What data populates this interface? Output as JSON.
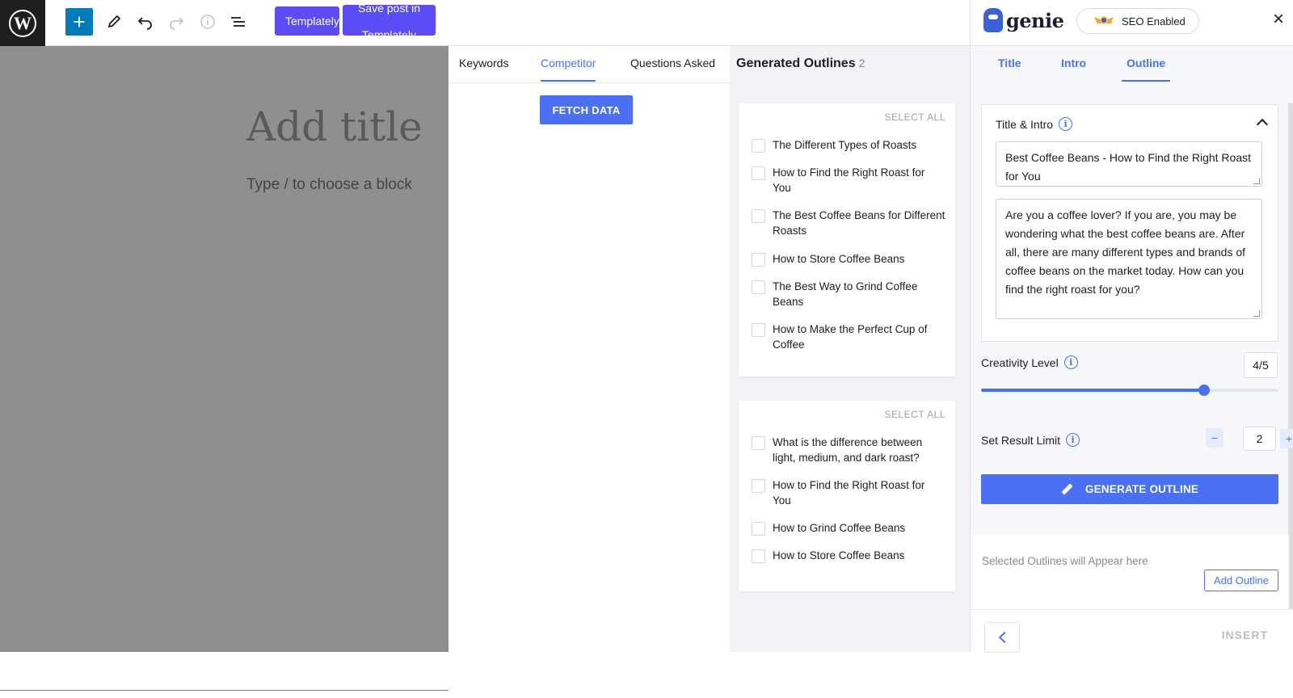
{
  "toolbar": {
    "templately_label": "Templately",
    "save_label": "Save post in Templately"
  },
  "editor": {
    "title_placeholder": "Add title",
    "block_hint": "Type / to choose a block"
  },
  "keywords_panel": {
    "tabs": [
      {
        "label": "Keywords",
        "active": false
      },
      {
        "label": "Competitor",
        "active": true
      },
      {
        "label": "Questions Asked",
        "active": false
      }
    ],
    "fetch_label": "FETCH DATA"
  },
  "generated": {
    "title": "Generated Outlines",
    "count": "2",
    "select_all": "SELECT ALL",
    "cards": [
      {
        "items": [
          "The Different Types of Roasts",
          "How to Find the Right Roast for You",
          "The Best Coffee Beans for Different Roasts",
          "How to Store Coffee Beans",
          "The Best Way to Grind Coffee Beans",
          "How to Make the Perfect Cup of Coffee"
        ]
      },
      {
        "items": [
          "What is the difference between light, medium, and dark roast?",
          "How to Find the Right Roast for You",
          "How to Grind Coffee Beans",
          "How to Store Coffee Beans"
        ]
      }
    ]
  },
  "genie": {
    "logo_text": "genie",
    "seo_label": "SEO Enabled",
    "close": "×",
    "tabs": [
      {
        "label": "Title",
        "active": false
      },
      {
        "label": "Intro",
        "active": false
      },
      {
        "label": "Outline",
        "active": true
      }
    ],
    "title_intro_label": "Title & Intro",
    "title_value": "Best Coffee Beans - How to Find the Right Roast for You",
    "intro_value": "Are you a coffee lover? If you are, you may be wondering what the best coffee beans are. After all, there are many different types and brands of coffee beans on the market today. How can you find the right roast for you?",
    "creativity_label": "Creativity Level",
    "creativity_value": "4/5",
    "creativity_level": 0.75,
    "result_limit_label": "Set Result Limit",
    "result_limit": "2",
    "minus": "−",
    "plus": "+",
    "generate_label": "GENERATE OUTLINE",
    "selected_hint": "Selected Outlines will Appear here",
    "add_outline_label": "Add Outline",
    "insert_label": "INSERT"
  },
  "colors": {
    "accent": "#4971f2",
    "templately": "#5b4cf5",
    "wp_blue": "#007cba"
  }
}
